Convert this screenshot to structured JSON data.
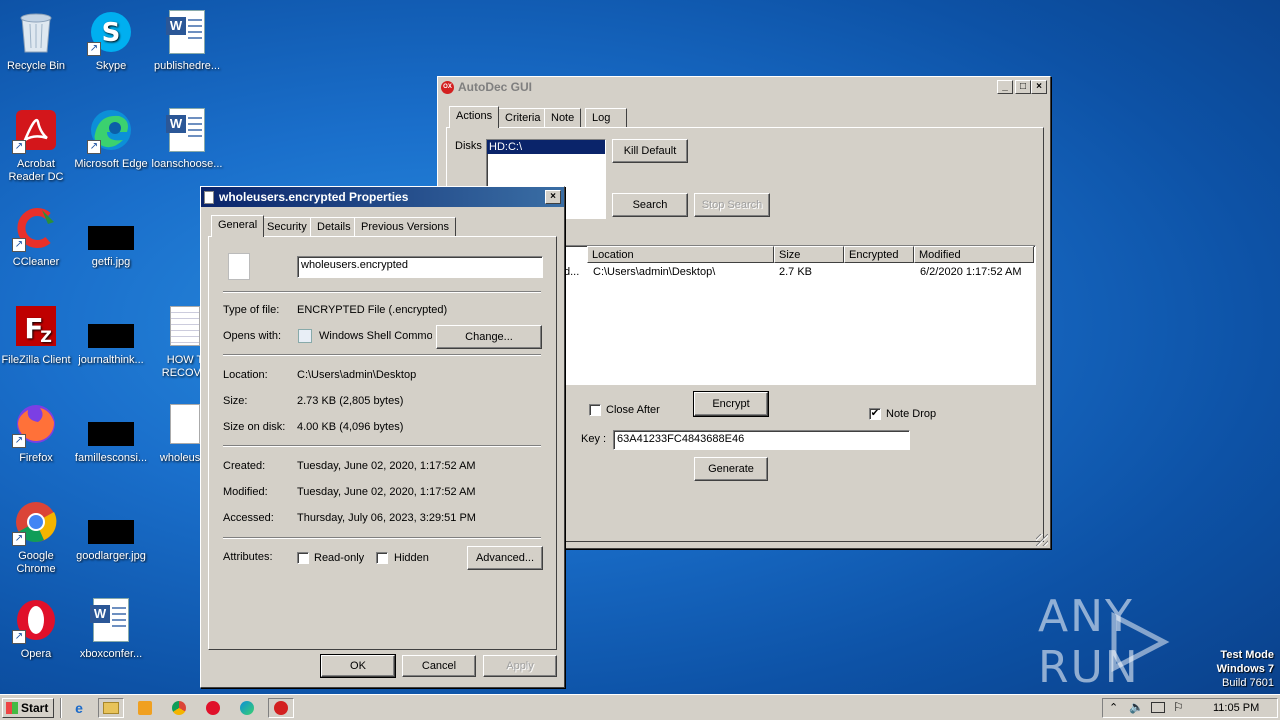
{
  "desktop": {
    "icons": [
      {
        "label": "Recycle Bin",
        "icon": "recycle-bin-icon"
      },
      {
        "label": "Skype",
        "icon": "skype-icon"
      },
      {
        "label": "publishedre...",
        "icon": "word-document-icon"
      },
      {
        "label": "Acrobat\nReader DC",
        "icon": "acrobat-icon"
      },
      {
        "label": "Microsoft Edge",
        "icon": "edge-icon"
      },
      {
        "label": "loanschoose...",
        "icon": "word-document-icon"
      },
      {
        "label": "CCleaner",
        "icon": "ccleaner-icon"
      },
      {
        "label": "getfi.jpg",
        "icon": "image-file-icon"
      },
      {
        "label": "FileZilla Client",
        "icon": "filezilla-icon"
      },
      {
        "label": "journalthink...",
        "icon": "image-file-icon"
      },
      {
        "label": "HOW T\nRECOVE",
        "icon": "text-file-icon"
      },
      {
        "label": "Firefox",
        "icon": "firefox-icon"
      },
      {
        "label": "famillesconsi...",
        "icon": "image-file-icon"
      },
      {
        "label": "wholeuser",
        "icon": "blank-file-icon"
      },
      {
        "label": "Google\nChrome",
        "icon": "chrome-icon"
      },
      {
        "label": "goodlarger.jpg",
        "icon": "image-file-icon"
      },
      {
        "label": "Opera",
        "icon": "opera-icon"
      },
      {
        "label": "xboxconfer...",
        "icon": "word-document-icon"
      }
    ],
    "watermark": "ANY RUN",
    "test_mode": [
      "Test Mode",
      "Windows 7",
      "Build 7601"
    ]
  },
  "autodec": {
    "title": "AutoDec GUI",
    "tabs": [
      "Actions",
      "Criteria",
      "Note",
      "Log"
    ],
    "disks_label": "Disks",
    "disks": [
      "HD:C:\\"
    ],
    "kill_default": "Kill Default",
    "search": "Search",
    "stop_search": "Stop Search",
    "columns": [
      "Location",
      "Size",
      "Encrypted",
      "Modified"
    ],
    "rows": [
      {
        "name_fragment": "d...",
        "location": "C:\\Users\\admin\\Desktop\\",
        "size": "2.7 KB",
        "encrypted": "",
        "modified": "6/2/2020 1:17:52 AM"
      }
    ],
    "close_after": "Close After",
    "encrypt": "Encrypt",
    "note_drop": "Note Drop",
    "key_label": "Key :",
    "key_value": "63A41233FC4843688E46",
    "generate": "Generate"
  },
  "props": {
    "title": "wholeusers.encrypted Properties",
    "tabs": [
      "General",
      "Security",
      "Details",
      "Previous Versions"
    ],
    "filename": "wholeusers.encrypted",
    "type_label": "Type of file:",
    "type_value": "ENCRYPTED File (.encrypted)",
    "opens_label": "Opens with:",
    "opens_value": "Windows Shell Commor",
    "change": "Change...",
    "location_label": "Location:",
    "location_value": "C:\\Users\\admin\\Desktop",
    "size_label": "Size:",
    "size_value": "2.73 KB (2,805 bytes)",
    "sizeondisk_label": "Size on disk:",
    "sizeondisk_value": "4.00 KB (4,096 bytes)",
    "created_label": "Created:",
    "created_value": "Tuesday, June 02, 2020, 1:17:52 AM",
    "modified_label": "Modified:",
    "modified_value": "Tuesday, June 02, 2020, 1:17:52 AM",
    "accessed_label": "Accessed:",
    "accessed_value": "Thursday, July 06, 2023, 3:29:51 PM",
    "attributes_label": "Attributes:",
    "readonly": "Read-only",
    "hidden": "Hidden",
    "advanced": "Advanced...",
    "ok": "OK",
    "cancel": "Cancel",
    "apply": "Apply"
  },
  "taskbar": {
    "start": "Start",
    "clock": "11:05 PM"
  }
}
